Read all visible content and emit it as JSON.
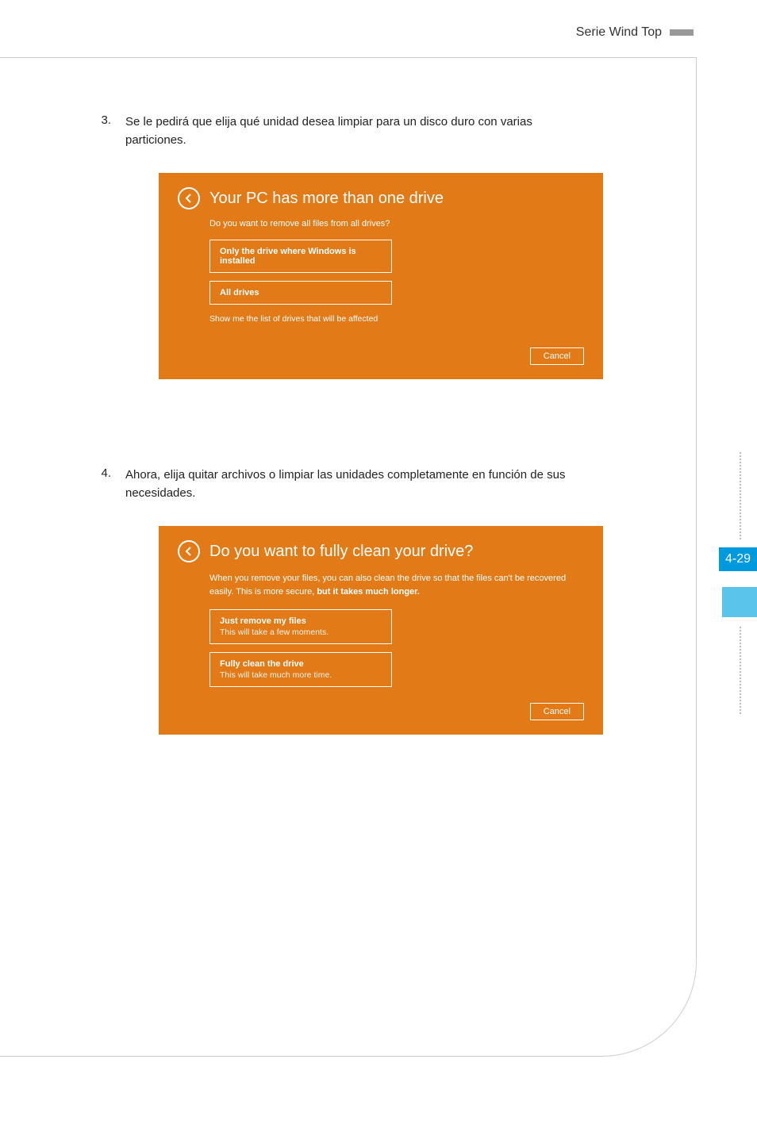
{
  "header": {
    "title": "Serie Wind Top"
  },
  "steps": {
    "s3": {
      "num": "3.",
      "text": "Se le pedirá que elija qué unidad desea limpiar para un disco duro con varias particiones."
    },
    "s4": {
      "num": "4.",
      "text": "Ahora, elija quitar archivos o limpiar las unidades completamente en función de sus necesidades."
    }
  },
  "panel1": {
    "title": "Your PC has more than one drive",
    "sub": "Do you want to remove all files from all drives?",
    "opt1": "Only the drive where Windows is installed",
    "opt2": "All drives",
    "link": "Show me the list of drives that will be affected",
    "cancel": "Cancel"
  },
  "panel2": {
    "title": "Do you want to fully clean your drive?",
    "desc_a": "When you remove your files, you can also clean the drive so that the files can't be recovered easily. This is more secure, ",
    "desc_b": "but it takes much longer.",
    "opt1_t": "Just remove my files",
    "opt1_s": "This will take a few moments.",
    "opt2_t": "Fully clean the drive",
    "opt2_s": "This will take much more time.",
    "cancel": "Cancel"
  },
  "pagenum": "4-29"
}
